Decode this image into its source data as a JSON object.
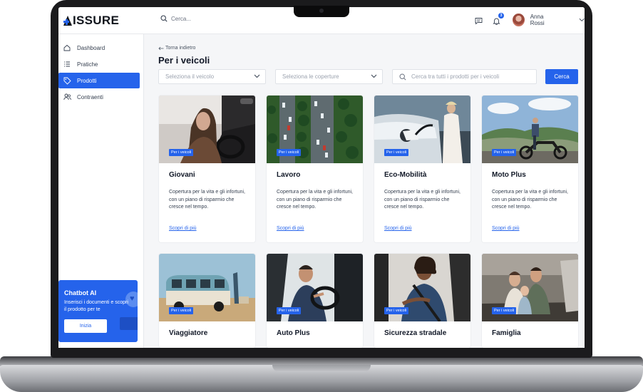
{
  "app": {
    "logo_text": "ISSURE",
    "search_placeholder": "Cerca..."
  },
  "header": {
    "notification_count": "3",
    "user_name": "Anna Rossi"
  },
  "sidebar": {
    "items": [
      {
        "label": "Dashboard",
        "icon": "home-icon",
        "active": false
      },
      {
        "label": "Pratiche",
        "icon": "list-icon",
        "active": false
      },
      {
        "label": "Prodotti",
        "icon": "tag-icon",
        "active": true
      },
      {
        "label": "Contraenti",
        "icon": "users-icon",
        "active": false
      }
    ],
    "chatbot": {
      "title": "Chatbot AI",
      "description": "Inserisci i documenti e scopri il prodotto per te",
      "button_label": "Inizia"
    }
  },
  "main": {
    "back_label": "Torna indietro",
    "title": "Per i veicoli",
    "filters": {
      "vehicle_placeholder": "Seleziona il veicolo",
      "coverage_placeholder": "Seleziona le coperture",
      "search_placeholder": "Cerca tra tutti i prodotti per i veicoli",
      "search_button": "Cerca"
    },
    "cards": [
      {
        "tag": "Per i veicoli",
        "name": "Giovani",
        "desc": "Copertura per la vita e gli infortuni, con un piano di risparmio che cresce nel tempo.",
        "link": "Scopri di più"
      },
      {
        "tag": "Per i veicoli",
        "name": "Lavoro",
        "desc": "Copertura per la vita e gli infortuni, con un piano di risparmio che cresce nel tempo.",
        "link": "Scopri di più"
      },
      {
        "tag": "Per i veicoli",
        "name": "Eco-Mobilità",
        "desc": "Copertura per la vita e gli infortuni, con un piano di risparmio che cresce nel tempo.",
        "link": "Scopri di più"
      },
      {
        "tag": "Per i veicoli",
        "name": "Moto Plus",
        "desc": "Copertura per la vita e gli infortuni, con un piano di risparmio che cresce nel tempo.",
        "link": "Scopri di più"
      },
      {
        "tag": "Per i veicoli",
        "name": "Viaggiatore"
      },
      {
        "tag": "Per i veicoli",
        "name": "Auto Plus"
      },
      {
        "tag": "Per i veicoli",
        "name": "Sicurezza stradale"
      },
      {
        "tag": "Per i veicoli",
        "name": "Famiglia"
      }
    ]
  },
  "colors": {
    "accent": "#2563eb",
    "background": "#f5f6f8",
    "text": "#111827"
  }
}
